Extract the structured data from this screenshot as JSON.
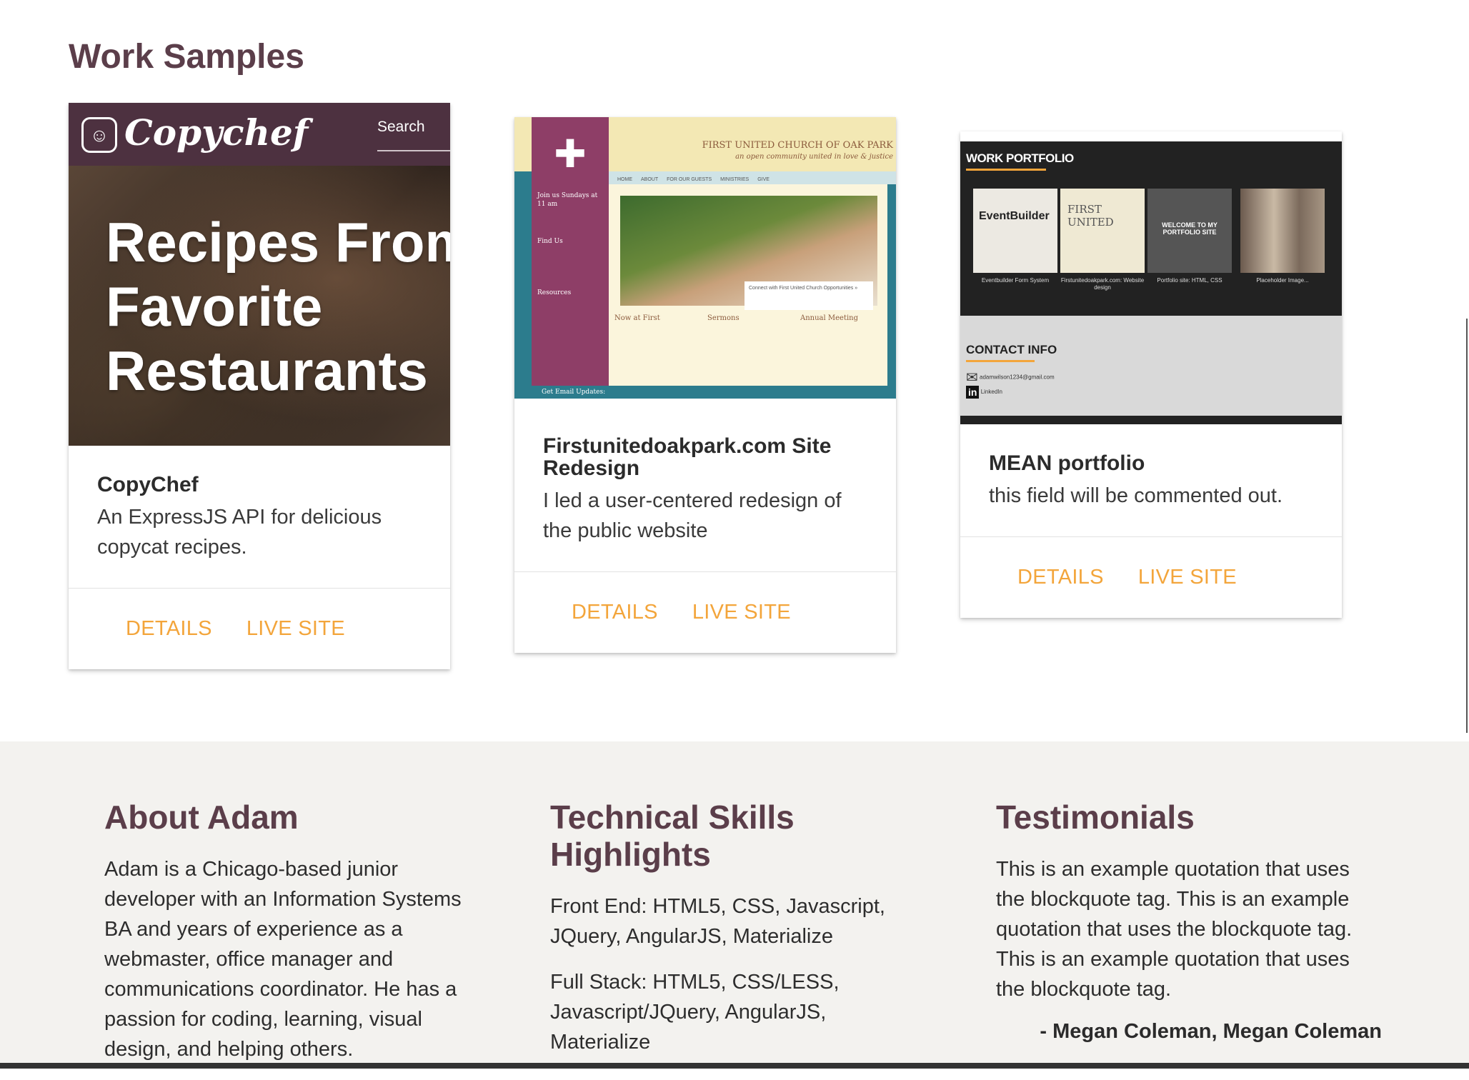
{
  "section_title": "Work Samples",
  "cards": [
    {
      "title": "CopyChef",
      "description": "An ExpressJS API for delicious copycat recipes.",
      "details": "DETAILS",
      "live_site": "LIVE SITE",
      "preview": {
        "logo": "Copychef",
        "search": "Search",
        "hero_line1": "Recipes From",
        "hero_line2": "Favorite",
        "hero_line3": "Restaurants"
      }
    },
    {
      "title": "Firstunitedoakpark.com Site Redesign",
      "description": "I led a user-centered redesign of the public website",
      "details": "DETAILS",
      "live_site": "LIVE SITE",
      "preview": {
        "site_title": "FIRST UNITED CHURCH OF OAK PARK",
        "site_subtitle": "an open community united in love & justice",
        "nav": [
          "HOME",
          "ABOUT",
          "FOR OUR GUESTS",
          "MINISTRIES",
          "GIVE"
        ],
        "sidebar": "Join us Sundays at 11 am",
        "sidebar_find": "Find Us",
        "sidebar_resources": "Resources",
        "caption": "Connect with First United Church Opportunities »",
        "col1": "Now at First",
        "col2": "Sermons",
        "col3": "Annual Meeting",
        "footer": "Get Email Updates:"
      }
    },
    {
      "title": "MEAN portfolio",
      "description": "this field will be commented out.",
      "details": "DETAILS",
      "live_site": "LIVE SITE",
      "preview": {
        "work_heading": "WORK PORTFOLIO",
        "thumbs": [
          {
            "label": "Eventbuilder Form System",
            "title": "EventBuilder"
          },
          {
            "label": "Firstunitedoakpark.com: Website design",
            "title": "FIRST UNITED"
          },
          {
            "label": "Portfolio site: HTML, CSS",
            "title": "WELCOME TO MY PORTFOLIO SITE"
          },
          {
            "label": "Placeholder Image...",
            "title": ""
          }
        ],
        "contact_heading": "CONTACT INFO",
        "email": "adamwilson1234@gmail.com",
        "linkedin": "LinkedIn"
      }
    }
  ],
  "about": {
    "heading": "About Adam",
    "text": "Adam is a Chicago-based junior developer with an Information Systems BA and years of experience as a webmaster, office manager and communications coordinator. He has a passion for coding, learning, visual design, and helping others."
  },
  "skills": {
    "heading": "Technical Skills Highlights",
    "front_end": "Front End: HTML5, CSS, Javascript, JQuery, AngularJS, Materialize",
    "full_stack": "Full Stack: HTML5, CSS/LESS, Javascript/JQuery, AngularJS, Materialize"
  },
  "testimonials": {
    "heading": "Testimonials",
    "quote": "This is an example quotation that uses the blockquote tag. This is an example quotation that uses the blockquote tag. This is an example quotation that uses the blockquote tag.",
    "author": "- Megan Coleman, Megan Coleman"
  },
  "colors": {
    "accent": "#f3a53b",
    "heading": "#5b3e4a",
    "band": "#f3f2ef"
  }
}
